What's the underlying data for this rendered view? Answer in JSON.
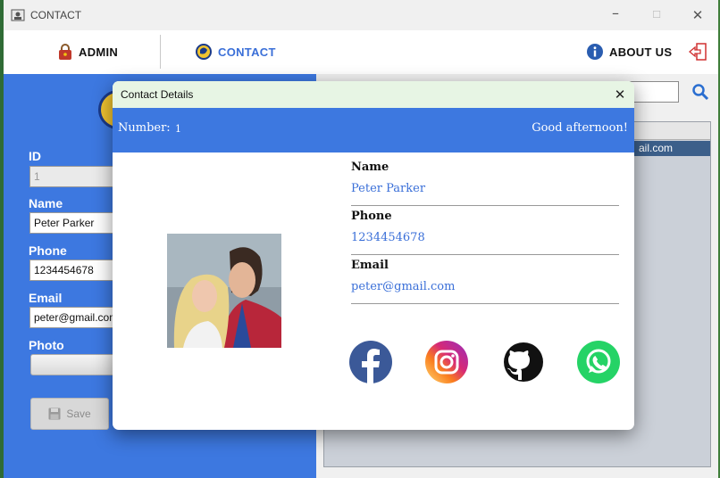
{
  "window": {
    "title": "CONTACT"
  },
  "nav": {
    "admin_label": "ADMIN",
    "contact_label": "CONTACT",
    "about_label": "ABOUT US"
  },
  "form": {
    "id_label": "ID",
    "id_value": "1",
    "name_label": "Name",
    "name_value": "Peter Parker",
    "phone_label": "Phone",
    "phone_value": "1234454678",
    "email_label": "Email",
    "email_value": "peter@gmail.com",
    "photo_label": "Photo",
    "save_label": "Save"
  },
  "table": {
    "selected_row_text": "ail.com"
  },
  "dialog": {
    "title": "Contact Details",
    "number_label": "Number:",
    "number_value": "1",
    "greeting": "Good afternoon!",
    "name_label": "Name",
    "name_value": "Peter Parker",
    "phone_label": "Phone",
    "phone_value": "1234454678",
    "email_label": "Email",
    "email_value": "peter@gmail.com",
    "social": [
      "facebook-icon",
      "instagram-icon",
      "github-icon",
      "whatsapp-icon"
    ]
  },
  "colors": {
    "accent_blue": "#3d78e0",
    "dialog_title_bg": "#e7f5e4",
    "link_blue": "#3a6fd8",
    "facebook": "#3b5998",
    "whatsapp": "#25d366"
  }
}
